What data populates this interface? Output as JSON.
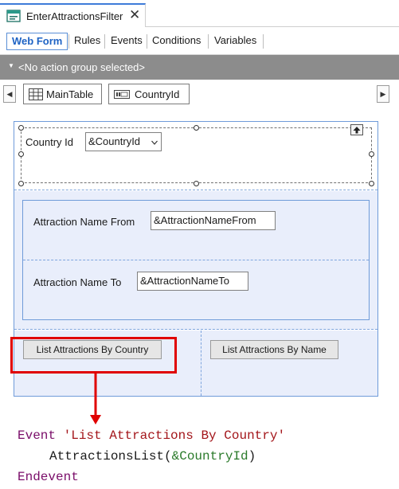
{
  "document_tab": {
    "title": "EnterAttractionsFilter",
    "close_glyph": "✕",
    "icon": "web-panel-icon"
  },
  "subtabs": [
    {
      "label": "Web Form",
      "active": true
    },
    {
      "label": "Rules",
      "active": false
    },
    {
      "label": "Events",
      "active": false
    },
    {
      "label": "Conditions",
      "active": false
    },
    {
      "label": "Variables",
      "active": false
    }
  ],
  "action_bar": {
    "label": "<No action group selected>",
    "arrow_glyph": "▼"
  },
  "breadcrumb": {
    "left_glyph": "◀",
    "right_glyph": "▶",
    "items": [
      {
        "label": "MainTable",
        "icon": "table-grid-icon"
      },
      {
        "label": "CountryId",
        "icon": "field-attribute-icon"
      }
    ]
  },
  "form": {
    "country_label": "Country Id",
    "country_combo_value": "&CountryId",
    "up_icon": "move-up-icon",
    "name_from_label": "Attraction Name From",
    "name_from_value": "&AttractionNameFrom",
    "name_to_label": "Attraction Name To",
    "name_to_value": "&AttractionNameTo",
    "button_by_country": "List Attractions By Country",
    "button_by_name": "List Attractions By Name"
  },
  "colors": {
    "accent": "#3e7bd9",
    "highlight": "#e00000",
    "keyword": "#7a0d69",
    "string": "#a3151a",
    "variable": "#2a7a2a"
  },
  "code": {
    "line1_keyword": "Event",
    "line1_string": "'List Attractions By Country'",
    "line2_call": "AttractionsList(",
    "line2_var": "&CountryId",
    "line2_close": ")",
    "line3_keyword": "Endevent"
  }
}
